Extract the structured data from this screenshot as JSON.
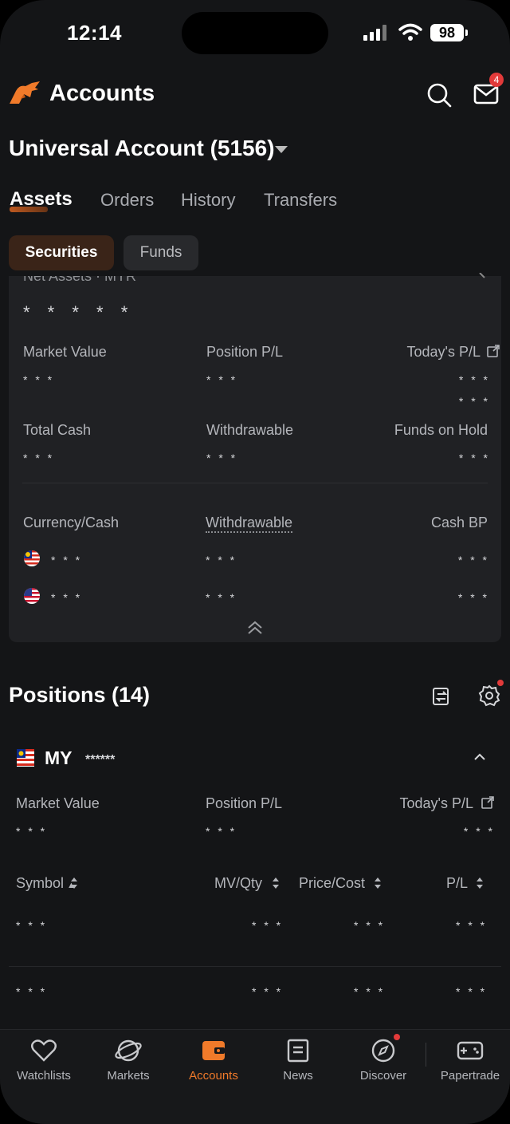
{
  "status_bar": {
    "time": "12:14",
    "battery": "98"
  },
  "header": {
    "title": "Accounts",
    "mail_badge": "4"
  },
  "account": {
    "title": "Universal Account (5156)"
  },
  "tabs": [
    {
      "label": "Assets",
      "active": true
    },
    {
      "label": "Orders",
      "active": false
    },
    {
      "label": "History",
      "active": false
    },
    {
      "label": "Transfers",
      "active": false
    }
  ],
  "chips": {
    "securities": "Securities",
    "funds": "Funds"
  },
  "summary": {
    "net_assets_label": "Net Assets · MYR",
    "net_assets_value": "* * * * *",
    "market_value_label": "Market Value",
    "market_value": "* * *",
    "position_pl_label": "Position P/L",
    "position_pl": "* * *",
    "todays_pl_label": "Today's P/L",
    "todays_pl": "* * *",
    "todays_pl_pct": "* * *",
    "total_cash_label": "Total Cash",
    "total_cash": "* * *",
    "withdrawable_label": "Withdrawable",
    "withdrawable": "* * *",
    "funds_on_hold_label": "Funds on Hold",
    "funds_on_hold": "* * *"
  },
  "currency": {
    "col1": "Currency/Cash",
    "col2": "Withdrawable",
    "col3": "Cash BP",
    "rows": [
      {
        "flag": "MY",
        "cash": "* * *",
        "withdrawable": "* * *",
        "bp": "* * *"
      },
      {
        "flag": "US",
        "cash": "* * *",
        "withdrawable": "* * *",
        "bp": "* * *"
      }
    ]
  },
  "positions": {
    "title": "Positions (14)",
    "market": "MY",
    "market_masked": "******",
    "market_value_label": "Market Value",
    "market_value": "* * *",
    "position_pl_label": "Position P/L",
    "position_pl": "* * *",
    "todays_pl_label": "Today's P/L",
    "todays_pl": "* * *",
    "columns": [
      "Symbol",
      "MV/Qty",
      "Price/Cost",
      "P/L"
    ],
    "rows": [
      {
        "symbol": "* * *",
        "mv": "* * *",
        "price": "* * *",
        "pl": "* * *"
      },
      {
        "symbol": "* * *",
        "mv": "* * *",
        "price": "* * *",
        "pl": "* * *"
      }
    ]
  },
  "nav": [
    {
      "label": "Watchlists",
      "icon": "heart-icon"
    },
    {
      "label": "Markets",
      "icon": "planet-icon"
    },
    {
      "label": "Accounts",
      "icon": "wallet-icon",
      "active": true
    },
    {
      "label": "News",
      "icon": "news-icon"
    },
    {
      "label": "Discover",
      "icon": "compass-icon"
    },
    {
      "label": "Papertrade",
      "icon": "gamepad-icon"
    }
  ],
  "colors": {
    "accent": "#f07a2a",
    "background": "#141517",
    "card": "#202124",
    "badge": "#e23a3a"
  }
}
